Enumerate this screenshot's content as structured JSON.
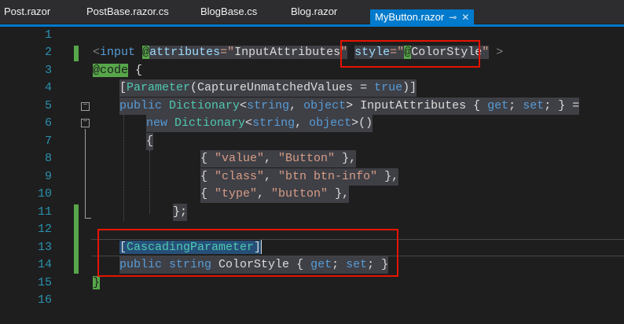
{
  "tabs": [
    {
      "label": "Post.razor",
      "active": false
    },
    {
      "label": "PostBase.razor.cs",
      "active": false
    },
    {
      "label": "BlogBase.cs",
      "active": false
    },
    {
      "label": "Blog.razor",
      "active": false
    },
    {
      "label": "MyButton.razor",
      "active": true
    }
  ],
  "line_numbers": [
    "1",
    "2",
    "3",
    "4",
    "5",
    "6",
    "7",
    "8",
    "9",
    "10",
    "11",
    "12",
    "13",
    "14",
    "15",
    "16"
  ],
  "code": {
    "l2": {
      "lt": "<",
      "tag": "input",
      "razor_at": "@",
      "attributes": "attributes",
      "eq1": "=\"",
      "input_attrs": "InputAttributes",
      "q1": "\"",
      "space": " ",
      "style": "style",
      "eq2": "=\"",
      "at2": "@",
      "color_style": "ColorStyle",
      "q2": "\"",
      "gt": " >"
    },
    "l3": {
      "at": "@",
      "code": "code",
      "brace": " {"
    },
    "l4": {
      "open": "[",
      "param": "Parameter",
      "paren": "(",
      "cuv": "CaptureUnmatchedValues",
      "eq": " = ",
      "true_kw": "true",
      "close": ")]"
    },
    "l5": {
      "public": "public",
      "dict": "Dictionary",
      "lt": "<",
      "string": "string",
      "comma": ", ",
      "object": "object",
      "gt": ">",
      "name": " InputAttributes { ",
      "get": "get",
      "semi": "; ",
      "set": "set",
      "end": "; } ="
    },
    "l6": {
      "new": "new",
      "dict": "Dictionary",
      "lt": "<",
      "string": "string",
      "comma": ", ",
      "object": "object",
      "gt": ">()"
    },
    "l7": "{",
    "l8": {
      "open": "{ ",
      "k": "\"value\"",
      "c": ", ",
      "v": "\"Button\"",
      "close": " },"
    },
    "l9": {
      "open": "{ ",
      "k": "\"class\"",
      "c": ", ",
      "v": "\"btn btn-info\"",
      "close": " },"
    },
    "l10": {
      "open": "{ ",
      "k": "\"type\"",
      "c": ", ",
      "v": "\"button\"",
      "close": " },"
    },
    "l11": "};",
    "l13": {
      "open": "[",
      "name": "CascadingParameter",
      "close": "]"
    },
    "l14": {
      "public": "public",
      "string": "string",
      "name": " ColorStyle { ",
      "get": "get",
      "semi": "; ",
      "set": "set",
      "end": "; }"
    },
    "l15": "}"
  },
  "colors": {
    "accent": "#007acc",
    "highlight_box": "#e51400",
    "change_bar": "#57a64a"
  }
}
